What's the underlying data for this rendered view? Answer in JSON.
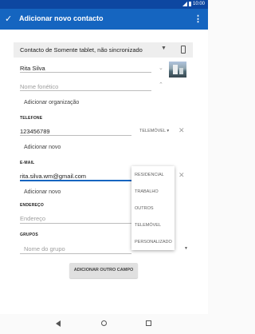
{
  "status": {
    "time": "10:00"
  },
  "toolbar": {
    "title": "Adicionar novo contacto"
  },
  "account": {
    "label": "Contacto de Somente tablet, não sincronizado"
  },
  "name": {
    "value": "Rita Silva"
  },
  "phonetic": {
    "placeholder": "Nome fonético"
  },
  "organization": {
    "label": "Adicionar organização"
  },
  "phone": {
    "section": "TELEFONE",
    "value": "123456789",
    "type": "TELEMÓVEL",
    "add_label": "Adicionar novo"
  },
  "email": {
    "section": "E-MAIL",
    "value": "rita.silva.wm@gmail.com",
    "add_label": "Adicionar novo"
  },
  "address": {
    "section": "ENDEREÇO",
    "placeholder": "Endereço"
  },
  "groups": {
    "section": "GRUPOS",
    "placeholder": "Nome do grupo"
  },
  "add_field_button": "ADICIONAR OUTRO CAMPO",
  "email_type_menu": [
    "RESIDENCIAL",
    "TRABALHO",
    "OUTROS",
    "TELEMÓVEL",
    "PERSONALIZADO"
  ],
  "colors": {
    "toolbar": "#1565c0",
    "statusbar": "#0d47a1",
    "accent": "#1565c0"
  }
}
